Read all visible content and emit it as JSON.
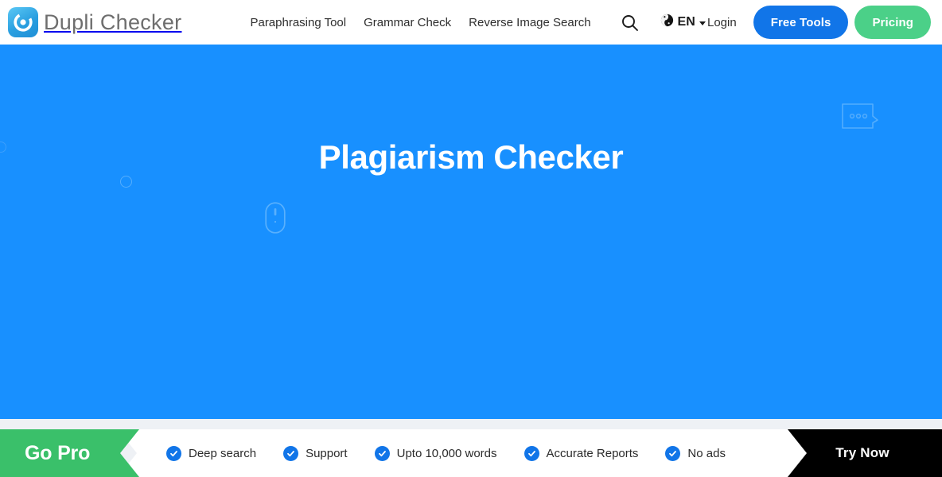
{
  "header": {
    "logo": {
      "icon": "dupli-checker-c-logo-icon",
      "text_bold": "Dupli",
      "text_light": " Checker",
      "full_text": "Dupli Checker"
    },
    "nav_links": [
      {
        "label": "Paraphrasing Tool"
      },
      {
        "label": "Grammar Check"
      },
      {
        "label": "Reverse Image Search"
      }
    ],
    "search_icon": "search-icon",
    "language": {
      "globe_icon": "globe-icon",
      "code": "EN",
      "caret_icon": "chevron-down-icon"
    },
    "login_label": "Login",
    "free_tools_label": "Free Tools",
    "pricing_label": "Pricing",
    "colors": {
      "free_tools_bg": "#1175e8",
      "pricing_bg": "#4bd088",
      "background": "#ffffff"
    }
  },
  "hero": {
    "title": "Plagiarism Checker",
    "background_color": "#1890ff",
    "title_color": "#ffffff",
    "decorations": [
      {
        "name": "circle-outline-decoration"
      },
      {
        "name": "computer-mouse-outline-decoration"
      },
      {
        "name": "chat-bubble-dots-decoration"
      },
      {
        "name": "edge-circle-decoration"
      }
    ]
  },
  "cta_bar": {
    "go_pro_label": "Go Pro",
    "go_pro_color": "#3ac06a",
    "features": [
      {
        "label": "Deep search",
        "icon": "check-circle-icon"
      },
      {
        "label": "Support",
        "icon": "check-circle-icon"
      },
      {
        "label": "Upto 10,000 words",
        "icon": "check-circle-icon"
      },
      {
        "label": "Accurate Reports",
        "icon": "check-circle-icon"
      },
      {
        "label": "No ads",
        "icon": "check-circle-icon"
      }
    ],
    "try_now_label": "Try Now",
    "try_now_bg": "#000000",
    "check_color": "#1175e8",
    "strip_bg": "#ffffff",
    "band_bg": "#eef1f5"
  }
}
